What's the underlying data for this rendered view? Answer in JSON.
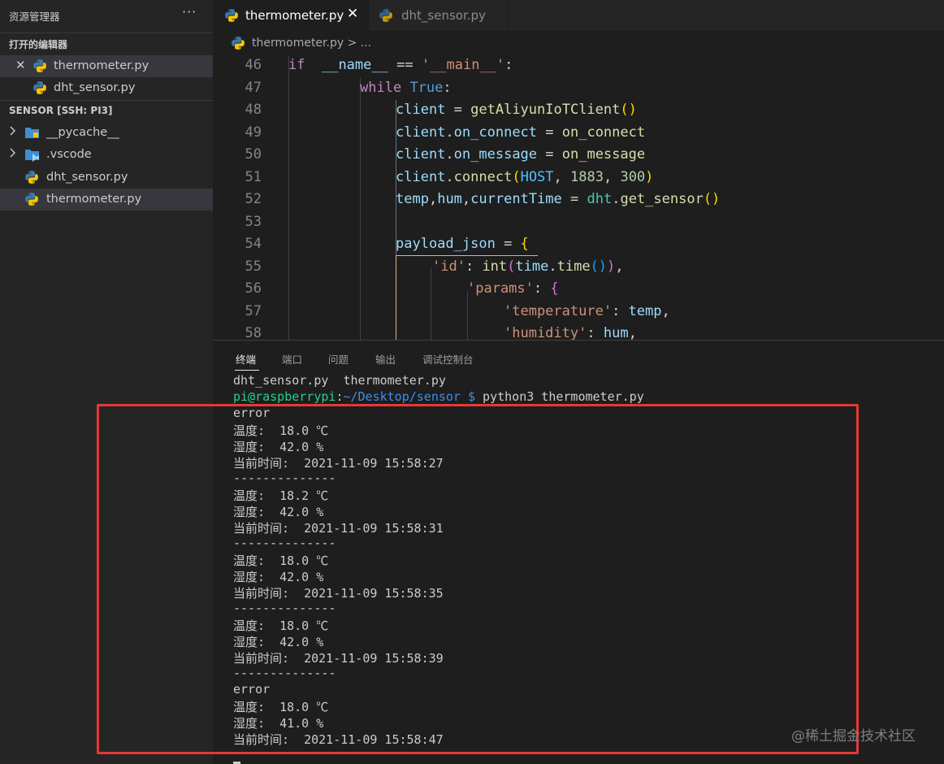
{
  "sidebar": {
    "title": "资源管理器",
    "more": "···",
    "open_editors": {
      "title": "打开的编辑器",
      "items": [
        {
          "label": "thermometer.py"
        },
        {
          "label": "dht_sensor.py"
        }
      ]
    },
    "workspace": {
      "title": "SENSOR [SSH: PI3]",
      "items": [
        {
          "label": "__pycache__",
          "icon": "folder-pycache-icon"
        },
        {
          "label": ".vscode",
          "icon": "folder-vscode-icon"
        },
        {
          "label": "dht_sensor.py",
          "icon": "python-file-icon"
        },
        {
          "label": "thermometer.py",
          "icon": "python-file-icon"
        }
      ]
    }
  },
  "tabs": [
    {
      "label": "thermometer.py",
      "close": "✕"
    },
    {
      "label": "dht_sensor.py"
    }
  ],
  "breadcrumb": {
    "text": "thermometer.py > ..."
  },
  "editor": {
    "lines": [
      {
        "num": "46",
        "tokens": [
          [
            "kw",
            "if"
          ],
          [
            "",
            "  "
          ],
          [
            "var",
            "__name__"
          ],
          [
            "",
            " == "
          ],
          [
            "str",
            "'__main__'"
          ],
          [
            "",
            ":"
          ]
        ]
      },
      {
        "num": "47",
        "tokens": [
          [
            "kw",
            "while"
          ],
          [
            "",
            " "
          ],
          [
            "bool",
            "True"
          ],
          [
            "",
            ":"
          ]
        ]
      },
      {
        "num": "48",
        "tokens": [
          [
            "var",
            "client"
          ],
          [
            "",
            " = "
          ],
          [
            "fn",
            "getAliyunIoTClient"
          ],
          [
            "b1",
            "()"
          ]
        ]
      },
      {
        "num": "49",
        "tokens": [
          [
            "var",
            "client"
          ],
          [
            "",
            "."
          ],
          [
            "var",
            "on_connect"
          ],
          [
            "",
            " = "
          ],
          [
            "fn",
            "on_connect"
          ]
        ]
      },
      {
        "num": "50",
        "tokens": [
          [
            "var",
            "client"
          ],
          [
            "",
            "."
          ],
          [
            "var",
            "on_message"
          ],
          [
            "",
            " = "
          ],
          [
            "fn",
            "on_message"
          ]
        ]
      },
      {
        "num": "51",
        "tokens": [
          [
            "var",
            "client"
          ],
          [
            "",
            "."
          ],
          [
            "fn",
            "connect"
          ],
          [
            "b1",
            "("
          ],
          [
            "const",
            "HOST"
          ],
          [
            "",
            ", "
          ],
          [
            "num",
            "1883"
          ],
          [
            "",
            ", "
          ],
          [
            "num",
            "300"
          ],
          [
            "b1",
            ")"
          ]
        ]
      },
      {
        "num": "52",
        "tokens": [
          [
            "var",
            "temp"
          ],
          [
            "",
            ","
          ],
          [
            "var",
            "hum"
          ],
          [
            "",
            ","
          ],
          [
            "var",
            "currentTime"
          ],
          [
            "",
            " = "
          ],
          [
            "cls",
            "dht"
          ],
          [
            "",
            "."
          ],
          [
            "fn",
            "get_sensor"
          ],
          [
            "b1",
            "()"
          ]
        ]
      },
      {
        "num": "53",
        "tokens": []
      },
      {
        "num": "54",
        "tokens": [
          [
            "var",
            "payload_json"
          ],
          [
            "",
            " = "
          ],
          [
            "b1",
            "{"
          ]
        ]
      },
      {
        "num": "55",
        "tokens": [
          [
            "str",
            "'id'"
          ],
          [
            "",
            ": "
          ],
          [
            "fn",
            "int"
          ],
          [
            "b2",
            "("
          ],
          [
            "var",
            "time"
          ],
          [
            "",
            "."
          ],
          [
            "fn",
            "time"
          ],
          [
            "b3",
            "()"
          ],
          [
            "b2",
            ")"
          ],
          [
            "",
            ","
          ]
        ]
      },
      {
        "num": "56",
        "tokens": [
          [
            "str",
            "'params'"
          ],
          [
            "",
            ": "
          ],
          [
            "b2",
            "{"
          ]
        ]
      },
      {
        "num": "57",
        "tokens": [
          [
            "str",
            "'temperature'"
          ],
          [
            "",
            ": "
          ],
          [
            "var",
            "temp"
          ],
          [
            "",
            ","
          ]
        ]
      },
      {
        "num": "58",
        "tokens": [
          [
            "str",
            "'humidity'"
          ],
          [
            "",
            ": "
          ],
          [
            "var",
            "hum"
          ],
          [
            "",
            ","
          ]
        ]
      }
    ]
  },
  "panel": {
    "tabs": [
      "终端",
      "端口",
      "问题",
      "输出",
      "调试控制台"
    ],
    "terminal": {
      "files": "dht_sensor.py  thermometer.py",
      "prompt_user": "pi@raspberrypi",
      "prompt_path": "~/Desktop/sensor $",
      "command": " python3 thermometer.py",
      "output": [
        "error",
        "温度:  18.0 ℃",
        "湿度:  42.0 %",
        "当前时间:  2021-11-09 15:58:27",
        "--------------",
        "温度:  18.2 ℃",
        "湿度:  42.0 %",
        "当前时间:  2021-11-09 15:58:31",
        "--------------",
        "温度:  18.0 ℃",
        "湿度:  42.0 %",
        "当前时间:  2021-11-09 15:58:35",
        "--------------",
        "温度:  18.0 ℃",
        "湿度:  42.0 %",
        "当前时间:  2021-11-09 15:58:39",
        "--------------",
        "error",
        "温度:  18.0 ℃",
        "湿度:  41.0 %",
        "当前时间:  2021-11-09 15:58:47"
      ]
    }
  },
  "watermark": "@稀土掘金技术社区",
  "colors": {
    "highlight_box": "#e53935",
    "prompt_user": "#23d18b",
    "prompt_path": "#3b8eea"
  }
}
